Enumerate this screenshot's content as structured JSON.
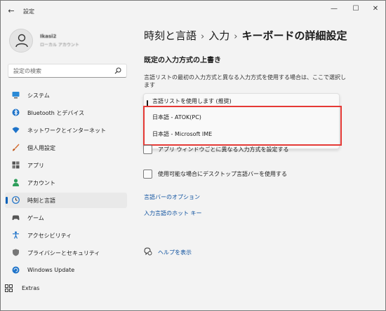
{
  "window": {
    "title": "設定",
    "back_glyph": "←",
    "controls": {
      "minimize": "—",
      "maximize": "☐",
      "close": "✕"
    }
  },
  "account": {
    "name": "Ikasi2",
    "type": "ローカル アカウント"
  },
  "search": {
    "placeholder": "設定の検索"
  },
  "sidebar": {
    "items": [
      {
        "label": "システム",
        "icon": "monitor-icon"
      },
      {
        "label": "Bluetooth とデバイス",
        "icon": "bluetooth-icon"
      },
      {
        "label": "ネットワークとインターネット",
        "icon": "wifi-icon"
      },
      {
        "label": "個人用設定",
        "icon": "brush-icon"
      },
      {
        "label": "アプリ",
        "icon": "apps-icon"
      },
      {
        "label": "アカウント",
        "icon": "person-icon"
      },
      {
        "label": "時刻と言語",
        "icon": "clock-globe-icon",
        "active": true
      },
      {
        "label": "ゲーム",
        "icon": "gamepad-icon"
      },
      {
        "label": "アクセシビリティ",
        "icon": "accessibility-icon"
      },
      {
        "label": "プライバシーとセキュリティ",
        "icon": "shield-icon"
      },
      {
        "label": "Windows Update",
        "icon": "update-icon"
      },
      {
        "label": "Extras",
        "icon": "extras-icon"
      }
    ]
  },
  "breadcrumb": {
    "items": [
      "時刻と言語",
      "入力",
      "キーボードの詳細設定"
    ],
    "separator": "›"
  },
  "main": {
    "section_title": "既定の入力方式の上書き",
    "description": "言語リストの最初の入力方式と異なる入力方式を使用する場合は、ここで選択します",
    "dropdown_options": [
      {
        "label": "言語リストを使用します (推奨)",
        "selected": true
      },
      {
        "label": "日本語 - ATOK(PC)"
      },
      {
        "label": "日本語 - Microsoft IME"
      }
    ],
    "checkboxes": [
      {
        "label": "アプリ ウィンドウごとに異なる入力方式を設定する",
        "checked": false
      },
      {
        "label": "使用可能な場合にデスクトップ言語バーを使用する",
        "checked": false
      }
    ],
    "links": [
      "言語バーのオプション",
      "入力言語のホット キー"
    ],
    "help": "ヘルプを表示"
  },
  "colors": {
    "accent": "#005fb8",
    "highlight_border": "#e53935",
    "link": "#0b4f9e"
  }
}
